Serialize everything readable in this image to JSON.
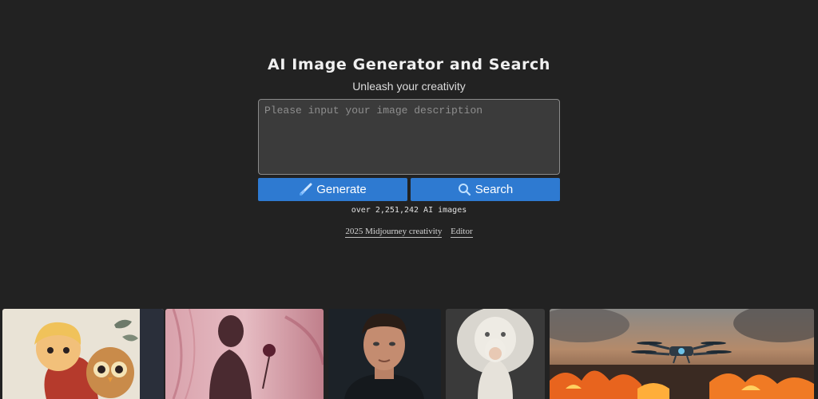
{
  "header": {
    "title": "AI Image Generator and Search",
    "subtitle": "Unleash your creativity"
  },
  "prompt": {
    "placeholder": "Please input your image description",
    "value": ""
  },
  "actions": {
    "generate_label": "Generate",
    "generate_icon": "brush-icon",
    "search_label": "Search",
    "search_icon": "magnifier-icon"
  },
  "stats": {
    "image_count": "over 2,251,242 AI images"
  },
  "links": {
    "midjourney": "2025 Midjourney creativity",
    "editor": "Editor"
  },
  "colors": {
    "background": "#222222",
    "accent": "#2e7ad1",
    "input_bg": "#3b3b3b"
  },
  "gallery": [
    {
      "subject": "cartoon-child-hugging-owl"
    },
    {
      "subject": "woman-silhouette-pink-veil-rose"
    },
    {
      "subject": "portrait-man-dark-background"
    },
    {
      "subject": "child-white-knit-outfit-white-lion"
    },
    {
      "subject": "drone-over-burning-city"
    }
  ]
}
